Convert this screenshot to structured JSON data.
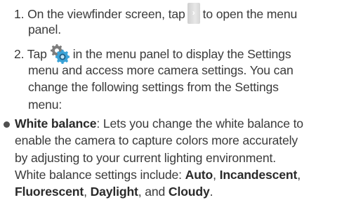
{
  "steps": [
    {
      "number": "1.",
      "line1_before": "On the viewfinder screen, tap",
      "line1_after": "to open the menu",
      "line2": "panel."
    },
    {
      "number": "2.",
      "line1_before": "Tap",
      "line1_after": "in the menu panel to display the Settings",
      "line2": "menu and access more camera settings. You can",
      "line3": "change the following settings from the Settings",
      "line4": "menu:"
    }
  ],
  "bullet": {
    "term": "White balance",
    "line1_rest": ": Lets you change the white balance to",
    "line2": "enable the camera to capture colors more accurately",
    "line3": "by adjusting to your current lighting environment.",
    "line4_lead": "White balance settings include: ",
    "opt_auto": "Auto",
    "sep1": ", ",
    "opt_incandescent": "Incandescent",
    "sep2": ",",
    "opt_fluorescent": "Fluorescent",
    "sep3": ", ",
    "opt_daylight": "Daylight",
    "sep4": ", and ",
    "opt_cloudy": "Cloudy",
    "end": "."
  },
  "icons": {
    "chevron": "chevron-right-icon",
    "settings": "gear-icon",
    "chevron_glyph": "›"
  }
}
